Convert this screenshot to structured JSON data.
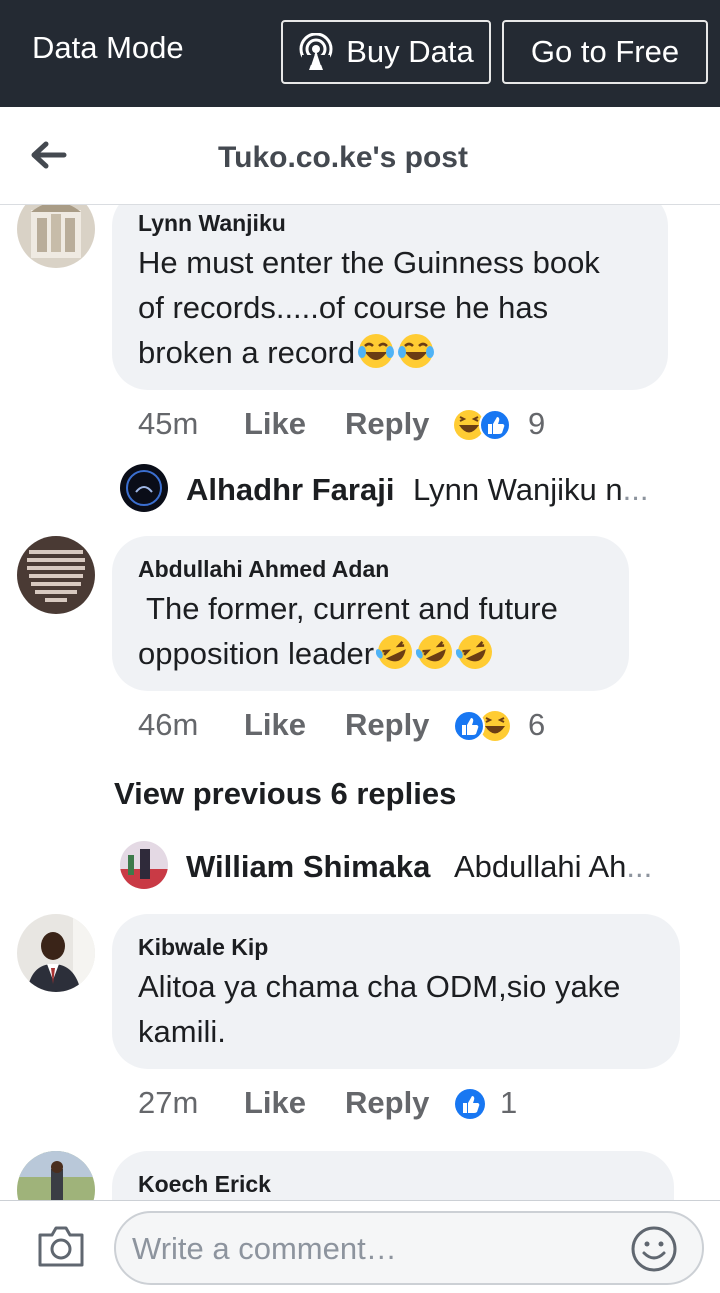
{
  "topbar": {
    "mode_label": "Data Mode",
    "buy_label": "Buy Data",
    "free_label": "Go to Free",
    "bg_color": "#242a33"
  },
  "header": {
    "title": "Tuko.co.ke's post",
    "back_icon": "arrow-left-icon"
  },
  "comments": [
    {
      "name": "Lynn Wanjiku",
      "lines": [
        "He must enter the Guinness book",
        "of records.....of course he has",
        "broken a record"
      ],
      "emoji": [
        "tears-of-joy",
        "tears-of-joy"
      ],
      "time": "45m",
      "like": "Like",
      "reply": "Reply",
      "reactions": [
        "haha",
        "like"
      ],
      "count": "9",
      "reply_preview": {
        "name": "Alhadhr Faraji",
        "text": "Lynn Wanjiku n",
        "ellipsis": "..."
      }
    },
    {
      "name": "Abdullahi Ahmed Adan",
      "lines": [
        " The former, current and future",
        "opposition leader"
      ],
      "emoji": [
        "rolling-laughing",
        "rolling-laughing",
        "rolling-laughing"
      ],
      "time": "46m",
      "like": "Like",
      "reply": "Reply",
      "reactions": [
        "like",
        "haha"
      ],
      "count": "6",
      "view_previous": "View previous 6 replies",
      "reply_preview": {
        "name": "William Shimaka",
        "text": "Abdullahi Ah",
        "ellipsis": "..."
      }
    },
    {
      "name": "Kibwale Kip",
      "lines": [
        "Alitoa ya chama cha ODM,sio yake",
        "kamili."
      ],
      "time": "27m",
      "like": "Like",
      "reply": "Reply",
      "reactions": [
        "like"
      ],
      "count": "1"
    },
    {
      "name": "Koech Erick"
    }
  ],
  "composer": {
    "placeholder": "Write a comment…",
    "camera_icon": "camera-icon",
    "emoji_icon": "smiley-icon"
  }
}
